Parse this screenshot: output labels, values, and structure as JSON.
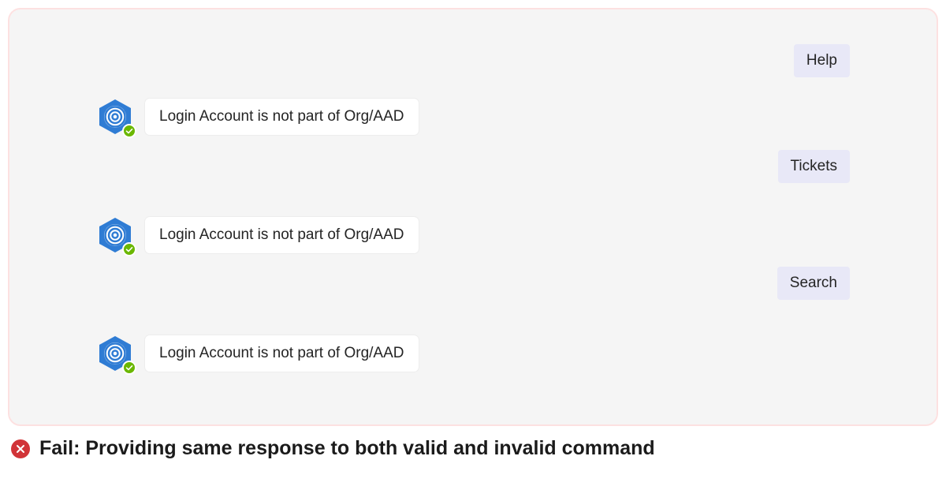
{
  "panel": {
    "chips": [
      "Help",
      "Tickets",
      "Search"
    ],
    "messages": [
      "Login Account is not part of Org/AAD",
      "Login Account is not part of Org/AAD",
      "Login Account is not part of Org/AAD"
    ]
  },
  "caption": {
    "text": "Fail: Providing same response to both valid and invalid command"
  }
}
